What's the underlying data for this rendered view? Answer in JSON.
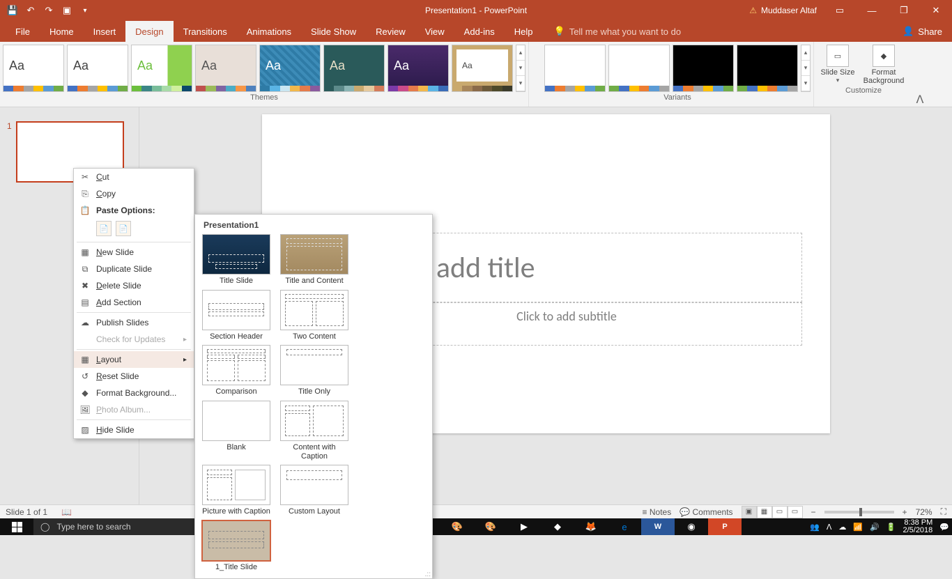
{
  "titlebar": {
    "title": "Presentation1 - PowerPoint",
    "user": "Muddaser Altaf"
  },
  "tabs": {
    "file": "File",
    "home": "Home",
    "insert": "Insert",
    "design": "Design",
    "transitions": "Transitions",
    "animations": "Animations",
    "slideshow": "Slide Show",
    "review": "Review",
    "view": "View",
    "addins": "Add-ins",
    "help": "Help",
    "tellme": "Tell me what you want to do",
    "share": "Share"
  },
  "ribbon": {
    "themes_label": "Themes",
    "variants_label": "Variants",
    "customize_label": "Customize",
    "slide_size": "Slide Size",
    "format_bg": "Format Background"
  },
  "slide": {
    "number": "1",
    "title_ph": "Click to add title",
    "subtitle_ph": "Click to add subtitle"
  },
  "context_menu": {
    "cut": "Cut",
    "copy": "Copy",
    "paste_options": "Paste Options:",
    "new_slide": "New Slide",
    "duplicate": "Duplicate Slide",
    "delete": "Delete Slide",
    "add_section": "Add Section",
    "publish": "Publish Slides",
    "check_updates": "Check for Updates",
    "layout": "Layout",
    "reset": "Reset Slide",
    "format_bg": "Format Background...",
    "photo_album": "Photo Album...",
    "hide": "Hide Slide"
  },
  "layout_gallery": {
    "title": "Presentation1",
    "items": [
      "Title Slide",
      "Title and Content",
      "Section Header",
      "Two Content",
      "Comparison",
      "Title Only",
      "Blank",
      "Content with Caption",
      "Picture with Caption",
      "Custom Layout",
      "1_Title Slide"
    ]
  },
  "statusbar": {
    "slide_info": "Slide 1 of 1",
    "notes": "Notes",
    "comments": "Comments",
    "zoom": "72%"
  },
  "taskbar": {
    "search_placeholder": "Type here to search",
    "time": "8:38 PM",
    "date": "2/5/2018"
  }
}
